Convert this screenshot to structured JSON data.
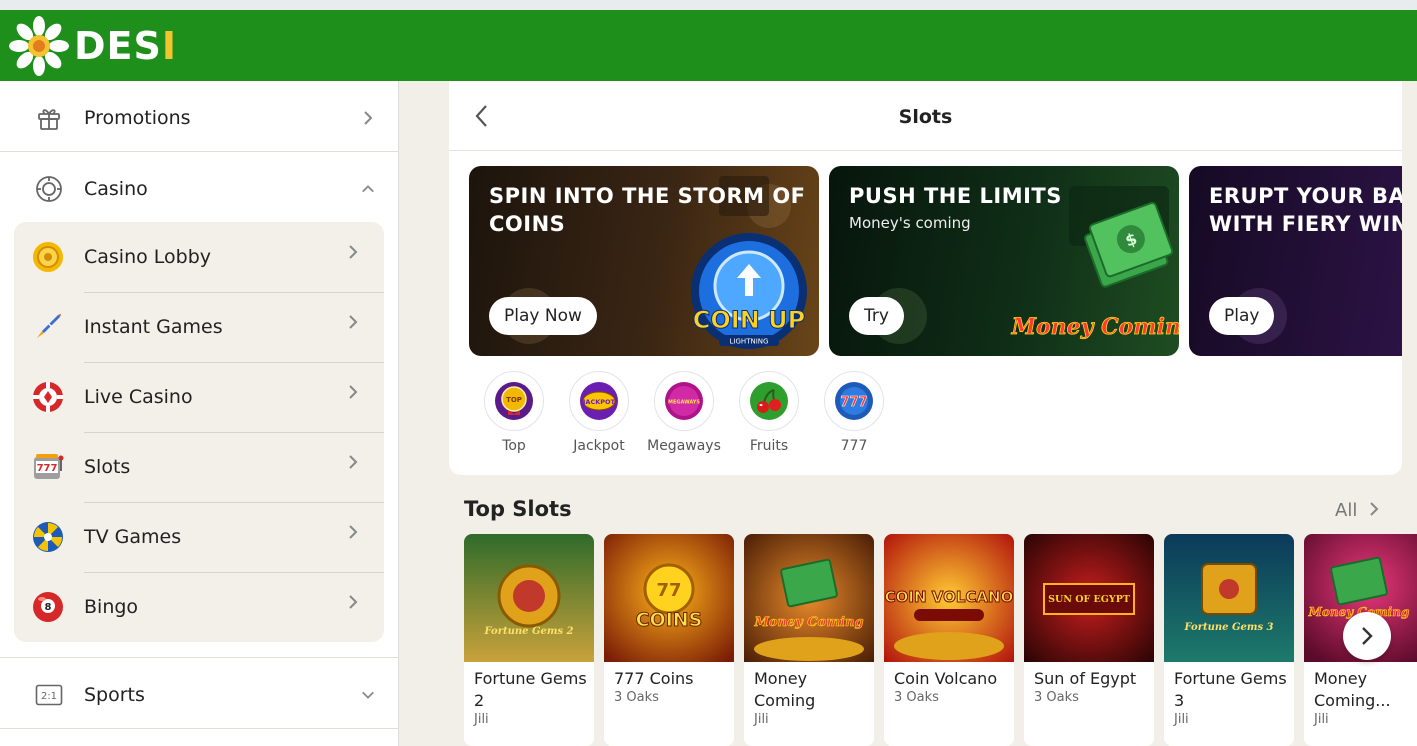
{
  "header": {
    "logo_text": "DES",
    "logo_text_i": "I"
  },
  "sidebar": {
    "promotions": {
      "label": "Promotions",
      "icon": "gift-icon"
    },
    "casino": {
      "label": "Casino",
      "icon": "chip-icon"
    },
    "casino_items": [
      {
        "label": "Casino Lobby",
        "icon": "coin-icon"
      },
      {
        "label": "Instant Games",
        "icon": "rocket-icon"
      },
      {
        "label": "Live Casino",
        "icon": "poker-chip-icon"
      },
      {
        "label": "Slots",
        "icon": "slot-machine-icon"
      },
      {
        "label": "TV Games",
        "icon": "wheel-icon"
      },
      {
        "label": "Bingo",
        "icon": "bingo-ball-icon"
      }
    ],
    "sports": {
      "label": "Sports",
      "icon": "scoreboard-icon"
    },
    "sports_icon_text": "2:1"
  },
  "main": {
    "title": "Slots",
    "banners": [
      {
        "title": "SPIN INTO THE STORM OF\nCOINS",
        "subtitle": "",
        "button": "Play Now",
        "art_text": "COIN UP",
        "art_sub": "LIGHTNING"
      },
      {
        "title": "PUSH THE LIMITS",
        "subtitle": "Money's coming",
        "button": "Try",
        "art_text": "Money Coming"
      },
      {
        "title": "ERUPT YOUR BAL\nWITH FIERY WINS",
        "subtitle": "",
        "button": "Play"
      }
    ],
    "categories": [
      {
        "label": "Top",
        "badge": "TOP"
      },
      {
        "label": "Jackpot",
        "badge": "JACKPOT"
      },
      {
        "label": "Megaways",
        "badge": "MEGAWAYS"
      },
      {
        "label": "Fruits"
      },
      {
        "label": "777",
        "badge": "777"
      }
    ],
    "section_title": "Top Slots",
    "all_link": "All",
    "games": [
      {
        "name": "Fortune Gems 2",
        "provider": "Jili",
        "art": "Fortune Gems 2"
      },
      {
        "name": "777 Coins",
        "provider": "3 Oaks",
        "art": "COINS"
      },
      {
        "name": "Money Coming",
        "provider": "Jili",
        "art": "Money Coming"
      },
      {
        "name": "Coin Volcano",
        "provider": "3 Oaks",
        "art": "COIN VOLCANO"
      },
      {
        "name": "Sun of Egypt",
        "provider": "3 Oaks",
        "art": "SUN OF EGYPT"
      },
      {
        "name": "Fortune Gems 3",
        "provider": "Jili",
        "art": "Fortune Gems 3"
      },
      {
        "name": "Money Coming...",
        "provider": "Jili",
        "art": "Money Coming"
      }
    ]
  }
}
